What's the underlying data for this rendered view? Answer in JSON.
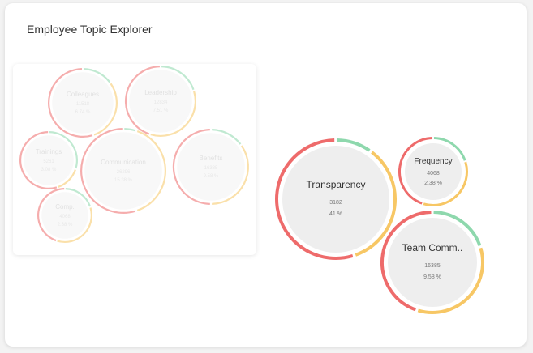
{
  "header": {
    "title": "Employee Topic Explorer"
  },
  "colors": {
    "red": "#ee6b6b",
    "yellow": "#f7c765",
    "green": "#8ed8ad",
    "fill": "#efefef"
  },
  "topics_panel": {
    "topics": [
      {
        "name": "Colleagues",
        "count": "11518",
        "pct": "6.74 %"
      },
      {
        "name": "Leadership",
        "count": "12834",
        "pct": "7.51 %"
      },
      {
        "name": "Trainings",
        "count": "5261",
        "pct": "3.08 %"
      },
      {
        "name": "Communication",
        "count": "26296",
        "pct": "15.38 %"
      },
      {
        "name": "Benefits",
        "count": "16385",
        "pct": "9.58 %"
      },
      {
        "name": "Comp.",
        "count": "4068",
        "pct": "2.38 %"
      }
    ]
  },
  "focus": {
    "topics": [
      {
        "name": "Transparency",
        "count": "3182",
        "pct": "41 %"
      },
      {
        "name": "Frequency",
        "count": "4068",
        "pct": "2.38 %"
      },
      {
        "name": "Team Comm..",
        "count": "16385",
        "pct": "9.58 %"
      }
    ]
  }
}
